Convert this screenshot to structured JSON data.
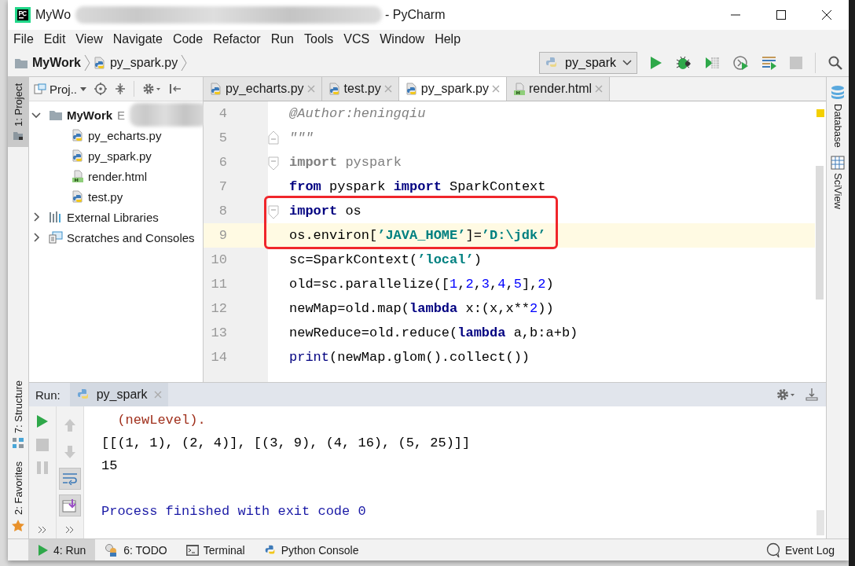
{
  "window": {
    "title_start": "MyWo",
    "title_end": "- PyCharm"
  },
  "menu": [
    {
      "label": "File"
    },
    {
      "label": "Edit"
    },
    {
      "label": "View"
    },
    {
      "label": "Navigate"
    },
    {
      "label": "Code"
    },
    {
      "label": "Refactor"
    },
    {
      "label": "Run"
    },
    {
      "label": "Tools"
    },
    {
      "label": "VCS"
    },
    {
      "label": "Window"
    },
    {
      "label": "Help"
    }
  ],
  "breadcrumbs": [
    {
      "label": "MyWork",
      "kind": "folder"
    },
    {
      "label": "py_spark.py",
      "kind": "python"
    }
  ],
  "run_config": {
    "label": "py_spark"
  },
  "toolbar": [
    {
      "kind": "run",
      "disabled": false
    },
    {
      "kind": "debug",
      "disabled": false
    },
    {
      "kind": "coverage",
      "disabled": false
    },
    {
      "kind": "profile",
      "disabled": false
    },
    {
      "kind": "concurrency",
      "disabled": false
    },
    {
      "kind": "stop",
      "disabled": true
    }
  ],
  "left_strip": [
    {
      "label": "1: Project",
      "kind": "project",
      "selected": true
    },
    {
      "label": "7: Structure",
      "kind": "structure",
      "selected": false
    },
    {
      "label": "2: Favorites",
      "kind": "favorites",
      "selected": false
    }
  ],
  "project_panel": {
    "title": "Proj..",
    "tree": [
      {
        "label": "MyWork",
        "path": "E",
        "kind": "folder",
        "expanded": true,
        "children": [
          {
            "label": "py_echarts.py",
            "kind": "python"
          },
          {
            "label": "py_spark.py",
            "kind": "python"
          },
          {
            "label": "render.html",
            "kind": "html"
          },
          {
            "label": "test.py",
            "kind": "python"
          }
        ]
      },
      {
        "label": "External Libraries",
        "kind": "library",
        "expanded": false
      },
      {
        "label": "Scratches and Consoles",
        "kind": "scratches",
        "expanded": false
      }
    ]
  },
  "editor": {
    "tabs": [
      {
        "label": "py_echarts.py",
        "kind": "python",
        "selected": false
      },
      {
        "label": "test.py",
        "kind": "python",
        "selected": false
      },
      {
        "label": "py_spark.py",
        "kind": "python",
        "selected": true
      },
      {
        "label": "render.html",
        "kind": "html",
        "selected": false
      }
    ],
    "lines": [
      {
        "number": "4",
        "current": false,
        "boxed": false,
        "tokens": [
          {
            "text": "@Author:heningqiu",
            "kind": "comment"
          }
        ]
      },
      {
        "number": "5",
        "current": false,
        "boxed": false,
        "fold": {
          "kind": "end"
        },
        "tokens": [
          {
            "text": "\"\"\"",
            "kind": "comment"
          }
        ]
      },
      {
        "number": "6",
        "current": false,
        "boxed": false,
        "fold": {
          "kind": "start"
        },
        "tokens": [
          {
            "text": "import",
            "kind": "unused-kw"
          },
          {
            "text": " pyspark",
            "kind": "unused"
          }
        ]
      },
      {
        "number": "7",
        "current": false,
        "boxed": false,
        "tokens": [
          {
            "text": "from",
            "kind": "kw"
          },
          {
            "text": " pyspark ",
            "kind": "plain"
          },
          {
            "text": "import",
            "kind": "kw"
          },
          {
            "text": " SparkContext",
            "kind": "plain"
          }
        ]
      },
      {
        "number": "8",
        "current": false,
        "boxed": true,
        "fold": {
          "kind": "start"
        },
        "tokens": [
          {
            "text": "import",
            "kind": "kw"
          },
          {
            "text": " os",
            "kind": "plain"
          }
        ]
      },
      {
        "number": "9",
        "current": true,
        "boxed": true,
        "tokens": [
          {
            "text": "os.environ[",
            "kind": "plain"
          },
          {
            "text": "’JAVA_HOME’",
            "kind": "str"
          },
          {
            "text": "]=",
            "kind": "plain"
          },
          {
            "text": "’D:\\jdk’",
            "kind": "str"
          }
        ]
      },
      {
        "number": "10",
        "current": false,
        "boxed": false,
        "tokens": [
          {
            "text": "sc=SparkContext(",
            "kind": "plain"
          },
          {
            "text": "’local’",
            "kind": "str"
          },
          {
            "text": ")",
            "kind": "plain"
          }
        ]
      },
      {
        "number": "11",
        "current": false,
        "boxed": false,
        "tokens": [
          {
            "text": "old=sc.parallelize([",
            "kind": "plain"
          },
          {
            "text": "1",
            "kind": "num"
          },
          {
            "text": ",",
            "kind": "plain"
          },
          {
            "text": "2",
            "kind": "num"
          },
          {
            "text": ",",
            "kind": "plain"
          },
          {
            "text": "3",
            "kind": "num"
          },
          {
            "text": ",",
            "kind": "plain"
          },
          {
            "text": "4",
            "kind": "num"
          },
          {
            "text": ",",
            "kind": "plain"
          },
          {
            "text": "5",
            "kind": "num"
          },
          {
            "text": "],",
            "kind": "plain"
          },
          {
            "text": "2",
            "kind": "num"
          },
          {
            "text": ")",
            "kind": "plain"
          }
        ]
      },
      {
        "number": "12",
        "current": false,
        "boxed": false,
        "tokens": [
          {
            "text": "newMap=old.map(",
            "kind": "plain"
          },
          {
            "text": "lambda",
            "kind": "kw"
          },
          {
            "text": " x:(x,x**",
            "kind": "plain"
          },
          {
            "text": "2",
            "kind": "num"
          },
          {
            "text": "))",
            "kind": "plain"
          }
        ]
      },
      {
        "number": "13",
        "current": false,
        "boxed": false,
        "tokens": [
          {
            "text": "newReduce=old.reduce(",
            "kind": "plain"
          },
          {
            "text": "lambda",
            "kind": "kw"
          },
          {
            "text": " a,b:a+b)",
            "kind": "plain"
          }
        ]
      },
      {
        "number": "14",
        "current": false,
        "boxed": false,
        "tokens": [
          {
            "text": "print",
            "kind": "builtin"
          },
          {
            "text": "(newMap.glom().collect())",
            "kind": "plain"
          }
        ]
      }
    ]
  },
  "right_strip": [
    {
      "label": "Database",
      "kind": "database"
    },
    {
      "label": "SciView",
      "kind": "sciview"
    }
  ],
  "run_panel": {
    "title": "Run:",
    "tab": "py_spark",
    "controls": [
      {
        "kind": "rerun",
        "disabled": false
      },
      {
        "kind": "stop",
        "disabled": true
      },
      {
        "kind": "pause",
        "disabled": true
      }
    ],
    "controls_2": [
      {
        "kind": "up",
        "on": false,
        "disabled": true
      },
      {
        "kind": "down",
        "on": false,
        "disabled": true
      },
      {
        "kind": "soft-wrap",
        "on": true
      },
      {
        "kind": "scroll-end",
        "on": true
      }
    ],
    "output": [
      {
        "text": "  (newLevel).",
        "kind": "stderr"
      },
      {
        "text": "[[(1, 1), (2, 4)], [(3, 9), (4, 16), (5, 25)]]",
        "kind": "stdout"
      },
      {
        "text": "15",
        "kind": "stdout"
      },
      {
        "kind": "blank"
      },
      {
        "text": "Process finished with exit code 0",
        "kind": "system"
      }
    ]
  },
  "status_bar": {
    "tools": [
      {
        "label": "4: Run",
        "kind": "run",
        "selected": true
      },
      {
        "label": "6: TODO",
        "kind": "todo",
        "selected": false
      },
      {
        "label": "Terminal",
        "kind": "terminal",
        "selected": false
      },
      {
        "label": "Python Console",
        "kind": "console",
        "selected": false
      }
    ],
    "event_log": "Event Log"
  }
}
